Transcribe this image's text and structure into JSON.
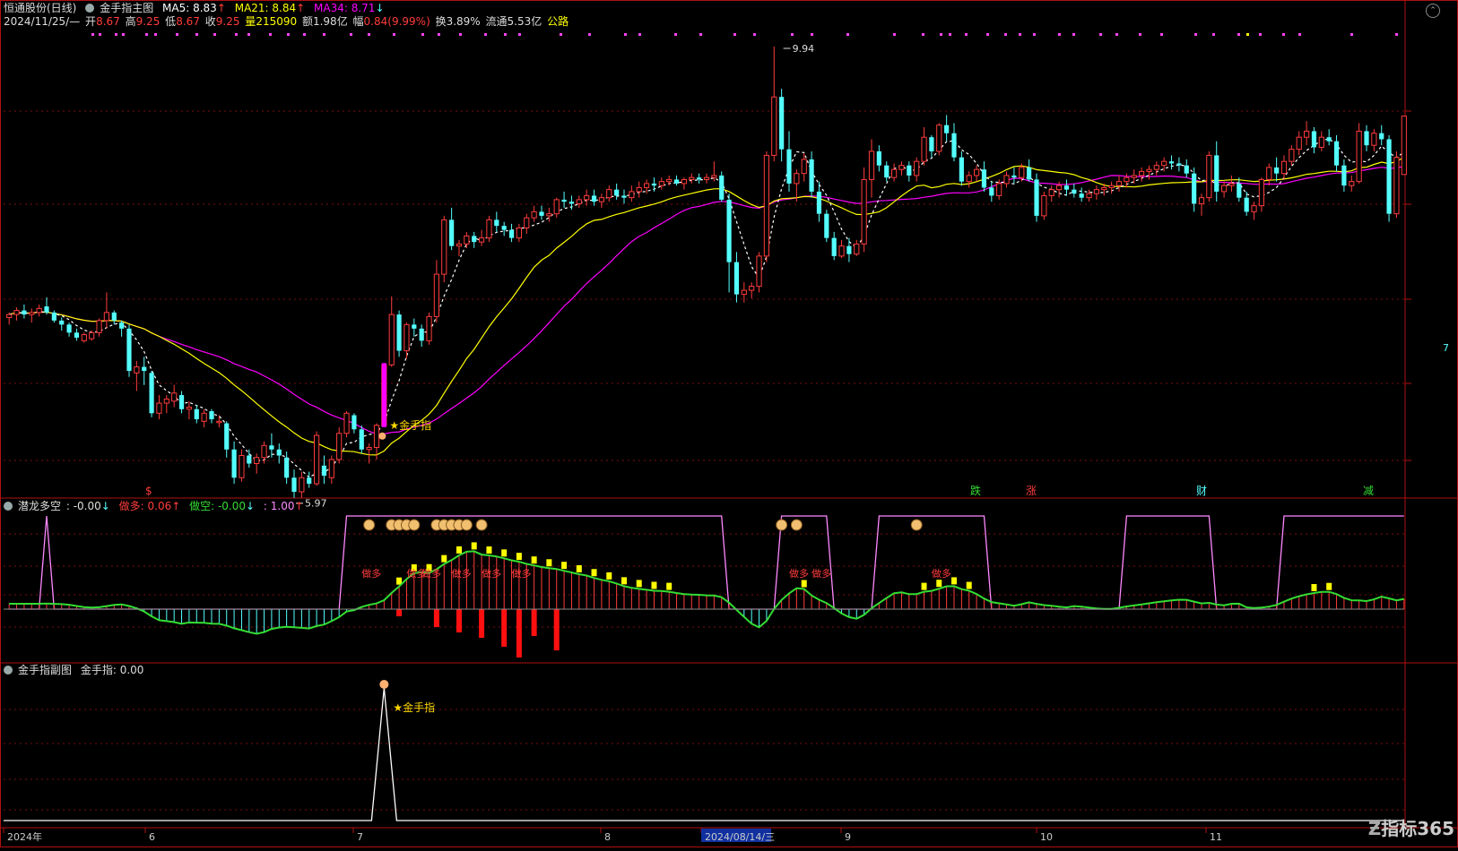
{
  "main": {
    "stock": "恒通股份(日线)",
    "indicator_name": "金手指主图",
    "ma5_label": "MA5: 8.83",
    "ma21_label": "MA21: 8.84",
    "ma34_label": "MA34: 8.71",
    "date": "2024/11/25/—",
    "open_label": "开",
    "open": "8.67",
    "high_label": "高",
    "high": "9.25",
    "low_label": "低",
    "low": "8.67",
    "close_label": "收",
    "close": "9.25",
    "vol_label": "量",
    "vol": "215090",
    "amount_label": "额",
    "amount": "1.98亿",
    "range_label": "幅",
    "range": "0.84(9.99%)",
    "turnover": "换3.89%",
    "float": "流通5.53亿",
    "sector": "公路",
    "signal_label": "★金手指",
    "high_mark": "9.94",
    "low_mark": "5.97",
    "right_edge_label": "7",
    "bottom_marks": [
      "$",
      "跌",
      "涨",
      "财",
      "减"
    ]
  },
  "sub1": {
    "name": "潜龙多空",
    "v1_label": ": -0.00",
    "v2_label": "做多: 0.06",
    "v3_label": "做空: -0.00",
    "v4_label": ": 1.00",
    "annot_word": "做多"
  },
  "sub2": {
    "name": "金手指副图",
    "value_label": "金手指: 0.00",
    "signal_label": "★金手指"
  },
  "xaxis": {
    "labels": [
      "2024年",
      "6",
      "7",
      "8",
      "2024/08/14/三",
      "9",
      "10",
      "11"
    ]
  },
  "logo": "指标365",
  "colors": {
    "up": "#ff3c3c",
    "down": "#54ffff",
    "ma5": "#ffffff",
    "ma21": "#ffff00",
    "ma34": "#ff00ff",
    "long": "#ff3c3c",
    "short": "#54ffff",
    "state": "#ff88ff",
    "midline": "#33dd33",
    "signal": "#ff00ff"
  },
  "chart_data": {
    "type": "candlestick",
    "ylim": [
      5.6,
      10.1
    ],
    "series": [
      {
        "type": "candle",
        "ohlc": [
          [
            7.25,
            7.3,
            7.18,
            7.28
          ],
          [
            7.28,
            7.35,
            7.22,
            7.32
          ],
          [
            7.32,
            7.38,
            7.24,
            7.28
          ],
          [
            7.28,
            7.34,
            7.2,
            7.3
          ],
          [
            7.3,
            7.38,
            7.26,
            7.34
          ],
          [
            7.36,
            7.45,
            7.28,
            7.3
          ],
          [
            7.3,
            7.32,
            7.2,
            7.22
          ],
          [
            7.22,
            7.25,
            7.12,
            7.18
          ],
          [
            7.18,
            7.2,
            7.06,
            7.1
          ],
          [
            7.1,
            7.14,
            7.02,
            7.05
          ],
          [
            7.02,
            7.1,
            7.0,
            7.08
          ],
          [
            7.04,
            7.12,
            7.02,
            7.1
          ],
          [
            7.1,
            7.24,
            7.06,
            7.22
          ],
          [
            7.22,
            7.5,
            7.14,
            7.3
          ],
          [
            7.3,
            7.32,
            7.18,
            7.22
          ],
          [
            7.2,
            7.22,
            7.06,
            7.14
          ],
          [
            7.14,
            7.18,
            6.66,
            6.72
          ],
          [
            6.7,
            6.82,
            6.52,
            6.76
          ],
          [
            6.76,
            6.86,
            6.58,
            6.72
          ],
          [
            6.7,
            6.72,
            6.26,
            6.3
          ],
          [
            6.3,
            6.48,
            6.24,
            6.4
          ],
          [
            6.4,
            6.48,
            6.3,
            6.44
          ],
          [
            6.42,
            6.58,
            6.36,
            6.5
          ],
          [
            6.48,
            6.52,
            6.3,
            6.34
          ],
          [
            6.34,
            6.42,
            6.24,
            6.36
          ],
          [
            6.34,
            6.38,
            6.2,
            6.24
          ],
          [
            6.22,
            6.34,
            6.16,
            6.3
          ],
          [
            6.32,
            6.34,
            6.2,
            6.24
          ],
          [
            6.22,
            6.28,
            6.16,
            6.22
          ],
          [
            6.2,
            6.22,
            5.86,
            5.94
          ],
          [
            5.94,
            6.02,
            5.6,
            5.66
          ],
          [
            5.66,
            5.94,
            5.62,
            5.88
          ],
          [
            5.88,
            5.94,
            5.76,
            5.8
          ],
          [
            5.8,
            5.9,
            5.7,
            5.86
          ],
          [
            5.86,
            6.02,
            5.8,
            5.98
          ],
          [
            5.98,
            6.1,
            5.86,
            5.94
          ],
          [
            5.94,
            6.0,
            5.8,
            5.88
          ],
          [
            5.86,
            5.92,
            5.6,
            5.66
          ],
          [
            5.66,
            5.74,
            5.46,
            5.52
          ],
          [
            5.52,
            5.72,
            5.46,
            5.66
          ],
          [
            5.66,
            5.72,
            5.56,
            5.6
          ],
          [
            5.6,
            6.12,
            5.58,
            6.08
          ],
          [
            5.78,
            5.88,
            5.6,
            5.68
          ],
          [
            5.66,
            5.88,
            5.6,
            5.84
          ],
          [
            5.84,
            6.16,
            5.8,
            6.1
          ],
          [
            6.1,
            6.32,
            6.06,
            6.3
          ],
          [
            6.28,
            6.3,
            6.1,
            6.14
          ],
          [
            6.14,
            6.18,
            5.9,
            5.94
          ],
          [
            5.94,
            6.0,
            5.8,
            5.96
          ],
          [
            5.96,
            6.2,
            5.84,
            6.18
          ],
          [
            6.18,
            6.78,
            6.18,
            6.78
          ],
          [
            6.78,
            7.46,
            6.76,
            7.28
          ],
          [
            7.28,
            7.32,
            6.86,
            6.92
          ],
          [
            6.92,
            7.2,
            6.84,
            7.18
          ],
          [
            7.18,
            7.24,
            7.06,
            7.14
          ],
          [
            7.14,
            7.18,
            6.96,
            7.02
          ],
          [
            7.02,
            7.3,
            6.98,
            7.26
          ],
          [
            7.26,
            7.82,
            7.2,
            7.68
          ],
          [
            7.68,
            8.26,
            7.6,
            8.22
          ],
          [
            8.22,
            8.34,
            7.92,
            7.96
          ],
          [
            7.96,
            8.02,
            7.86,
            7.98
          ],
          [
            7.98,
            8.1,
            7.94,
            8.06
          ],
          [
            8.06,
            8.1,
            7.94,
            8.0
          ],
          [
            8.0,
            8.12,
            7.96,
            8.04
          ],
          [
            8.04,
            8.26,
            8.0,
            8.22
          ],
          [
            8.22,
            8.3,
            8.1,
            8.16
          ],
          [
            8.16,
            8.2,
            8.06,
            8.12
          ],
          [
            8.12,
            8.18,
            8.0,
            8.04
          ],
          [
            8.04,
            8.18,
            8.0,
            8.14
          ],
          [
            8.14,
            8.28,
            8.08,
            8.24
          ],
          [
            8.24,
            8.36,
            8.2,
            8.3
          ],
          [
            8.3,
            8.36,
            8.22,
            8.26
          ],
          [
            8.26,
            8.34,
            8.2,
            8.28
          ],
          [
            8.28,
            8.44,
            8.24,
            8.42
          ],
          [
            8.42,
            8.5,
            8.34,
            8.4
          ],
          [
            8.4,
            8.46,
            8.32,
            8.38
          ],
          [
            8.38,
            8.46,
            8.34,
            8.42
          ],
          [
            8.42,
            8.52,
            8.36,
            8.46
          ],
          [
            8.46,
            8.52,
            8.36,
            8.4
          ],
          [
            8.4,
            8.48,
            8.34,
            8.44
          ],
          [
            8.44,
            8.56,
            8.4,
            8.52
          ],
          [
            8.52,
            8.58,
            8.42,
            8.46
          ],
          [
            8.46,
            8.52,
            8.38,
            8.44
          ],
          [
            8.44,
            8.56,
            8.4,
            8.5
          ],
          [
            8.5,
            8.6,
            8.44,
            8.54
          ],
          [
            8.54,
            8.62,
            8.48,
            8.58
          ],
          [
            8.58,
            8.64,
            8.5,
            8.56
          ],
          [
            8.56,
            8.64,
            8.52,
            8.6
          ],
          [
            8.6,
            8.66,
            8.56,
            8.62
          ],
          [
            8.62,
            8.66,
            8.56,
            8.58
          ],
          [
            8.58,
            8.64,
            8.52,
            8.62
          ],
          [
            8.62,
            8.68,
            8.58,
            8.64
          ],
          [
            8.64,
            8.68,
            8.58,
            8.62
          ],
          [
            8.62,
            8.68,
            8.58,
            8.64
          ],
          [
            8.64,
            8.8,
            8.6,
            8.66
          ],
          [
            8.66,
            8.7,
            8.4,
            8.42
          ],
          [
            8.42,
            8.48,
            7.5,
            7.8
          ],
          [
            7.8,
            7.9,
            7.4,
            7.48
          ],
          [
            7.48,
            7.6,
            7.4,
            7.52
          ],
          [
            7.52,
            7.6,
            7.44,
            7.56
          ],
          [
            7.56,
            7.9,
            7.5,
            7.86
          ],
          [
            7.86,
            8.9,
            7.8,
            8.86
          ],
          [
            8.86,
            9.94,
            8.8,
            9.44
          ],
          [
            9.44,
            9.52,
            8.8,
            8.92
          ],
          [
            8.92,
            9.1,
            8.5,
            8.58
          ],
          [
            8.58,
            8.72,
            8.4,
            8.68
          ],
          [
            8.68,
            8.88,
            8.6,
            8.82
          ],
          [
            8.82,
            8.9,
            8.44,
            8.5
          ],
          [
            8.5,
            8.6,
            8.2,
            8.28
          ],
          [
            8.28,
            8.32,
            8.0,
            8.04
          ],
          [
            8.04,
            8.1,
            7.82,
            7.86
          ],
          [
            7.86,
            8.02,
            7.84,
            7.96
          ],
          [
            7.96,
            8.04,
            7.8,
            7.88
          ],
          [
            7.88,
            8.02,
            7.86,
            7.98
          ],
          [
            7.98,
            8.74,
            7.9,
            8.62
          ],
          [
            8.62,
            9.02,
            8.44,
            8.9
          ],
          [
            8.9,
            8.96,
            8.7,
            8.76
          ],
          [
            8.76,
            8.8,
            8.6,
            8.64
          ],
          [
            8.64,
            8.78,
            8.6,
            8.72
          ],
          [
            8.72,
            8.8,
            8.66,
            8.76
          ],
          [
            8.76,
            8.8,
            8.6,
            8.66
          ],
          [
            8.66,
            8.84,
            8.6,
            8.8
          ],
          [
            8.8,
            9.14,
            8.76,
            9.04
          ],
          [
            9.04,
            9.06,
            8.84,
            8.9
          ],
          [
            8.9,
            9.18,
            8.86,
            9.16
          ],
          [
            9.16,
            9.26,
            9.0,
            9.08
          ],
          [
            9.08,
            9.18,
            8.8,
            8.84
          ],
          [
            8.84,
            8.9,
            8.56,
            8.6
          ],
          [
            8.6,
            8.7,
            8.54,
            8.66
          ],
          [
            8.66,
            8.76,
            8.6,
            8.72
          ],
          [
            8.72,
            8.8,
            8.5,
            8.54
          ],
          [
            8.54,
            8.6,
            8.4,
            8.46
          ],
          [
            8.46,
            8.62,
            8.42,
            8.58
          ],
          [
            8.58,
            8.7,
            8.54,
            8.66
          ],
          [
            8.66,
            8.74,
            8.58,
            8.64
          ],
          [
            8.64,
            8.78,
            8.6,
            8.74
          ],
          [
            8.74,
            8.82,
            8.6,
            8.62
          ],
          [
            8.62,
            8.68,
            8.2,
            8.26
          ],
          [
            8.26,
            8.5,
            8.22,
            8.46
          ],
          [
            8.46,
            8.56,
            8.4,
            8.52
          ],
          [
            8.52,
            8.6,
            8.44,
            8.56
          ],
          [
            8.56,
            8.62,
            8.46,
            8.52
          ],
          [
            8.52,
            8.58,
            8.44,
            8.48
          ],
          [
            8.48,
            8.54,
            8.4,
            8.44
          ],
          [
            8.44,
            8.52,
            8.4,
            8.48
          ],
          [
            8.48,
            8.56,
            8.42,
            8.52
          ],
          [
            8.52,
            8.58,
            8.46,
            8.54
          ],
          [
            8.54,
            8.6,
            8.48,
            8.56
          ],
          [
            8.56,
            8.66,
            8.5,
            8.6
          ],
          [
            8.6,
            8.68,
            8.54,
            8.64
          ],
          [
            8.64,
            8.72,
            8.58,
            8.66
          ],
          [
            8.66,
            8.74,
            8.6,
            8.7
          ],
          [
            8.7,
            8.76,
            8.62,
            8.72
          ],
          [
            8.72,
            8.8,
            8.66,
            8.76
          ],
          [
            8.76,
            8.84,
            8.7,
            8.8
          ],
          [
            8.8,
            8.86,
            8.72,
            8.78
          ],
          [
            8.78,
            8.84,
            8.7,
            8.76
          ],
          [
            8.76,
            8.82,
            8.64,
            8.68
          ],
          [
            8.68,
            8.74,
            8.3,
            8.38
          ],
          [
            8.38,
            8.48,
            8.26,
            8.44
          ],
          [
            8.44,
            8.9,
            8.4,
            8.86
          ],
          [
            8.86,
            9.0,
            8.4,
            8.5
          ],
          [
            8.5,
            8.6,
            8.44,
            8.56
          ],
          [
            8.56,
            8.66,
            8.5,
            8.58
          ],
          [
            8.58,
            8.64,
            8.4,
            8.44
          ],
          [
            8.44,
            8.5,
            8.26,
            8.3
          ],
          [
            8.3,
            8.4,
            8.22,
            8.36
          ],
          [
            8.36,
            8.64,
            8.3,
            8.62
          ],
          [
            8.62,
            8.78,
            8.56,
            8.74
          ],
          [
            8.74,
            8.84,
            8.6,
            8.68
          ],
          [
            8.68,
            8.86,
            8.62,
            8.8
          ],
          [
            8.8,
            8.96,
            8.76,
            8.92
          ],
          [
            8.92,
            9.1,
            8.86,
            9.04
          ],
          [
            9.04,
            9.2,
            8.96,
            9.1
          ],
          [
            9.1,
            9.14,
            8.88,
            8.94
          ],
          [
            8.94,
            9.1,
            8.9,
            9.04
          ],
          [
            9.04,
            9.12,
            8.96,
            9.0
          ],
          [
            9.0,
            9.06,
            8.7,
            8.76
          ],
          [
            8.76,
            8.82,
            8.5,
            8.56
          ],
          [
            8.56,
            8.66,
            8.5,
            8.6
          ],
          [
            8.6,
            9.18,
            8.58,
            9.1
          ],
          [
            9.1,
            9.16,
            8.9,
            8.96
          ],
          [
            8.96,
            9.12,
            8.9,
            9.08
          ],
          [
            9.08,
            9.16,
            8.96,
            9.02
          ],
          [
            9.02,
            9.06,
            8.2,
            8.28
          ],
          [
            8.28,
            8.9,
            8.24,
            8.84
          ],
          [
            8.67,
            9.25,
            8.67,
            9.25
          ]
        ]
      },
      {
        "name": "MA5",
        "type": "line"
      },
      {
        "name": "MA21",
        "type": "line"
      },
      {
        "name": "MA34",
        "type": "line"
      }
    ],
    "signals": [
      {
        "index": 50,
        "label": "★金手指"
      }
    ]
  }
}
